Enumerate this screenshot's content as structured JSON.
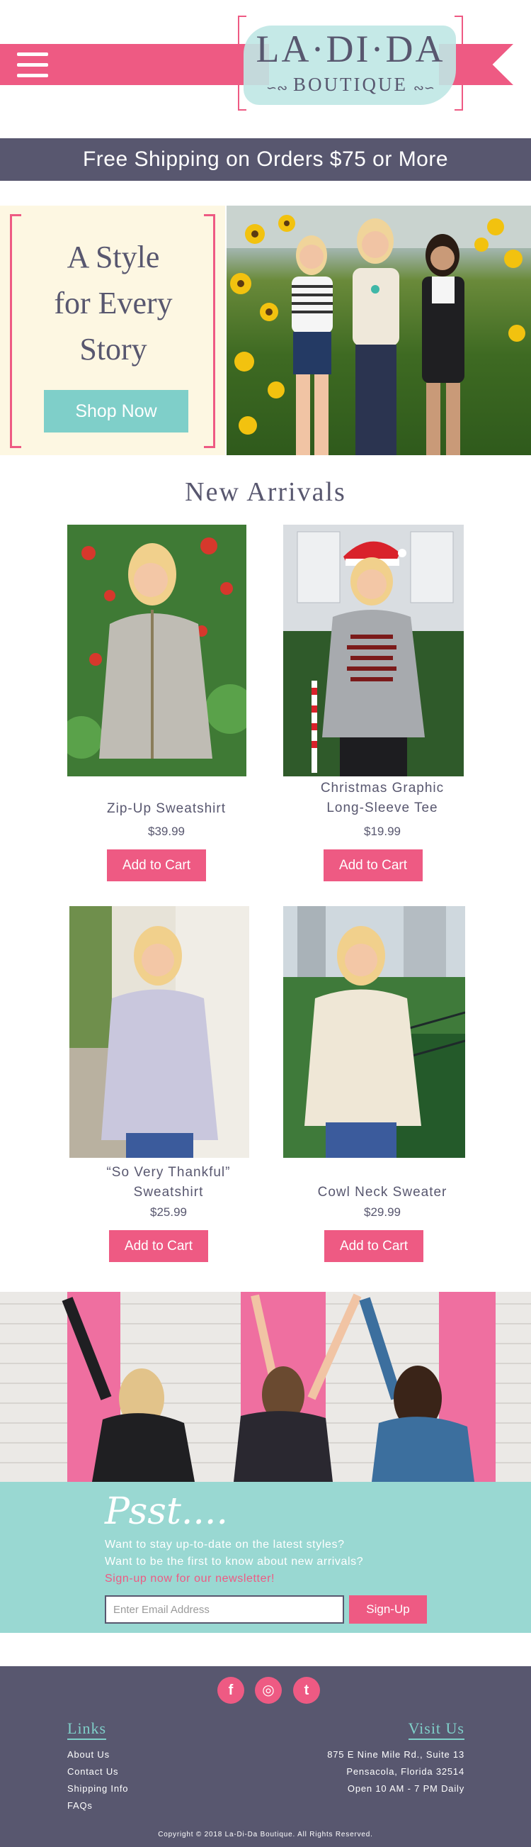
{
  "header": {
    "menu_icon": "hamburger-menu-icon",
    "logo": {
      "name": "LA·DI·DA",
      "sub": "BOUTIQUE"
    }
  },
  "banner": {
    "text": "Free Shipping on Orders $75 or More"
  },
  "hero": {
    "title_lines": [
      "A Style",
      "for Every",
      "Story"
    ],
    "cta": "Shop Now"
  },
  "new_arrivals": {
    "title": "New Arrivals",
    "products": [
      {
        "name_lines": [
          "Zip-Up Sweatshirt"
        ],
        "price": "$39.99",
        "cta": "Add to Cart"
      },
      {
        "name_lines": [
          "Christmas Graphic",
          "Long-Sleeve Tee"
        ],
        "price": "$19.99",
        "cta": "Add to Cart"
      },
      {
        "name_lines": [
          "“So Very Thankful”",
          "Sweatshirt"
        ],
        "price": "$25.99",
        "cta": "Add to Cart"
      },
      {
        "name_lines": [
          "Cowl Neck Sweater"
        ],
        "price": "$29.99",
        "cta": "Add to Cart"
      }
    ]
  },
  "newsletter": {
    "heading": "Psst....",
    "lines": [
      "Want to stay up-to-date on the latest styles?",
      "Want to be the first to know about new arrivals?",
      "Sign-up now for our newsletter!"
    ],
    "email_placeholder": "Enter Email Address",
    "signup": "Sign-Up"
  },
  "footer": {
    "social": [
      {
        "icon": "facebook-icon",
        "glyph": "f"
      },
      {
        "icon": "instagram-icon",
        "glyph": "◎"
      },
      {
        "icon": "twitter-icon",
        "glyph": "t"
      }
    ],
    "links_heading": "Links",
    "links": [
      "About Us",
      "Contact Us",
      "Shipping Info",
      "FAQs"
    ],
    "visit_heading": "Visit Us",
    "address": [
      "875 E Nine Mile Rd., Suite 13",
      "Pensacola, Florida 32514",
      "Open 10 AM - 7 PM Daily"
    ],
    "copyright": "Copyright © 2018 La-Di-Da Boutique. All Rights Reserved."
  },
  "colors": {
    "pink": "#ee5a83",
    "teal": "#7fcfc9",
    "slate": "#58576f",
    "cream": "#fdf7e2",
    "mint": "#99d8d2"
  }
}
